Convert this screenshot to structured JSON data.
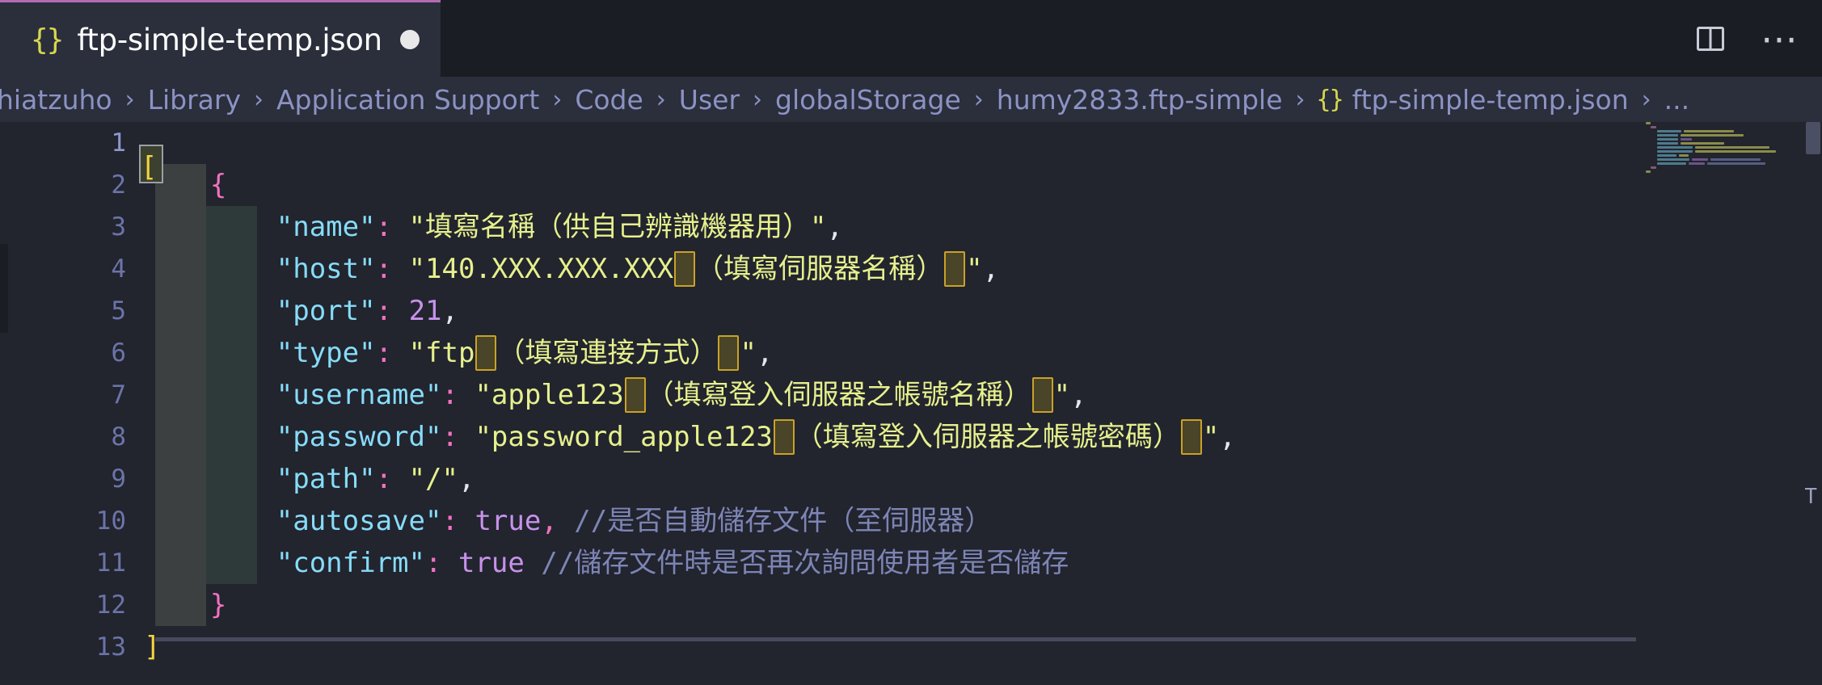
{
  "window": {
    "tab": {
      "icon": "json-braces-icon",
      "icon_glyph": "{}",
      "filename": "ftp-simple-temp.json",
      "dirty": true
    },
    "actions": {
      "split_editor_label": "Split Editor",
      "more_actions_label": "⋯"
    }
  },
  "breadcrumb": {
    "items": [
      "hiatzuho",
      "Library",
      "Application Support",
      "Code",
      "User",
      "globalStorage",
      "humy2833.ftp-simple",
      "ftp-simple-temp.json",
      "..."
    ],
    "separator": "›",
    "file_icon_glyph": "{}"
  },
  "editor": {
    "language": "json",
    "line_numbers": [
      "1",
      "2",
      "3",
      "4",
      "5",
      "6",
      "7",
      "8",
      "9",
      "10",
      "11",
      "12",
      "13"
    ],
    "active_line": 1,
    "cursor_line": 1,
    "lines": [
      {
        "num": "1",
        "raw": "["
      },
      {
        "num": "2",
        "raw": "    {"
      },
      {
        "num": "3",
        "raw": "        \"name\": \"填寫名稱（供自己辨識機器用）\","
      },
      {
        "num": "4",
        "raw": "        \"host\": \"140.XXX.XXX.XXX　（填寫伺服器名稱）　\","
      },
      {
        "num": "5",
        "raw": "        \"port\": 21,"
      },
      {
        "num": "6",
        "raw": "        \"type\": \"ftp　（填寫連接方式）　\","
      },
      {
        "num": "7",
        "raw": "        \"username\": \"apple123　（填寫登入伺服器之帳號名稱）　\","
      },
      {
        "num": "8",
        "raw": "        \"password\": \"password_apple123　（填寫登入伺服器之帳號密碼）　\","
      },
      {
        "num": "9",
        "raw": "        \"path\": \"/\","
      },
      {
        "num": "10",
        "raw": "        \"autosave\": true, //是否自動儲存文件（至伺服器）"
      },
      {
        "num": "11",
        "raw": "        \"confirm\": true //儲存文件時是否再次詢問使用者是否儲存"
      },
      {
        "num": "12",
        "raw": "    }"
      },
      {
        "num": "13",
        "raw": "]"
      }
    ],
    "tokens": {
      "l1_bracket": "[",
      "l2_brace": "{",
      "l3_key": "\"name\"",
      "l3_colon": ":",
      "l3_value": "\"填寫名稱（供自己辨識機器用）\"",
      "l3_comma": ",",
      "l4_key": "\"host\"",
      "l4_value_pre": "\"140.XXX.XXX.XXX",
      "l4_value_mid": "（填寫伺服器名稱）",
      "l4_value_post": "\"",
      "l5_key": "\"port\"",
      "l5_value": "21",
      "l6_key": "\"type\"",
      "l6_value_pre": "\"ftp",
      "l6_value_mid": "（填寫連接方式）",
      "l6_value_post": "\"",
      "l7_key": "\"username\"",
      "l7_value_pre": "\"apple123",
      "l7_value_mid": "（填寫登入伺服器之帳號名稱）",
      "l7_value_post": "\"",
      "l8_key": "\"password\"",
      "l8_value_pre": "\"password_apple123",
      "l8_value_mid": "（填寫登入伺服器之帳號密碼）",
      "l8_value_post": "\"",
      "l9_key": "\"path\"",
      "l9_value": "\"/\"",
      "l10_key": "\"autosave\"",
      "l10_value": "true",
      "l10_comment": "//是否自動儲存文件（至伺服器）",
      "l11_key": "\"confirm\"",
      "l11_value": "true",
      "l11_comment": "//儲存文件時是否再次詢問使用者是否儲存",
      "l12_brace": "}",
      "l13_bracket": "]",
      "colon": ":",
      "comma": ","
    }
  },
  "colors": {
    "editor_background": "#22242e",
    "tab_active_background": "#2b2e3b",
    "tabbar_background": "#1b1d25",
    "tab_top_border": "#b36ab3",
    "breadcrumb_foreground": "#8b93c4",
    "line_number_foreground": "#6b74a8",
    "json_key": "#86dcf8",
    "json_string": "#e6f08d",
    "json_punctuation": "#f272c0",
    "json_boolean": "#c792ea",
    "json_comment": "#7d85b5",
    "bracket_yellow": "#f3d53f",
    "unicode_highlight_border": "#c9a227",
    "unicode_highlight_background": "#4a4428",
    "indent_guide": "#3c4040",
    "scrollbar": "#4b4f63"
  },
  "overlay": {
    "right_edge_letter": "T"
  }
}
